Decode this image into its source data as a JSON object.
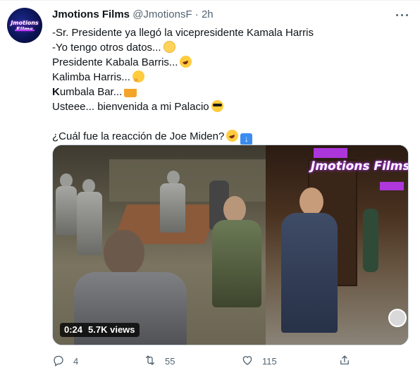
{
  "tweet": {
    "avatar_text": "Jmotions Films",
    "author_name": "Jmotions Films",
    "handle": "@JmotionsF",
    "separator": "·",
    "time": "2h",
    "lines": [
      "-Sr. Presidente ya llegó la vicepresidente Kamala Harris",
      "-Yo tengo otros datos...",
      "Presidente Kabala Barris...",
      "Kalimba Harris...",
      "Kumbala Bar...",
      "Usteee... bienvenida a mi Palacio",
      "¿Cuál fue la reacción de Joe Miden?"
    ],
    "line4_bold_prefix": "K",
    "line4_rest": "umbala",
    "line4_suffix": " Bar...",
    "emojis": {
      "line1": "slightly-smiling-face",
      "line2": "rolling-on-floor-laughing",
      "line3": "thinking-face",
      "line4": "clinking-beer-mugs",
      "line5": "smiling-face-with-sunglasses",
      "line6a": "rolling-on-floor-laughing",
      "line6b": "down-arrow"
    }
  },
  "media": {
    "watermark": "Jmotions Films",
    "duration": "0:24",
    "views": "5.7K views"
  },
  "actions": {
    "reply_count": "4",
    "retweet_count": "55",
    "like_count": "115"
  },
  "colors": {
    "text_primary": "#0f1419",
    "text_secondary": "#536471",
    "watermark_glow": "#c23bff"
  }
}
